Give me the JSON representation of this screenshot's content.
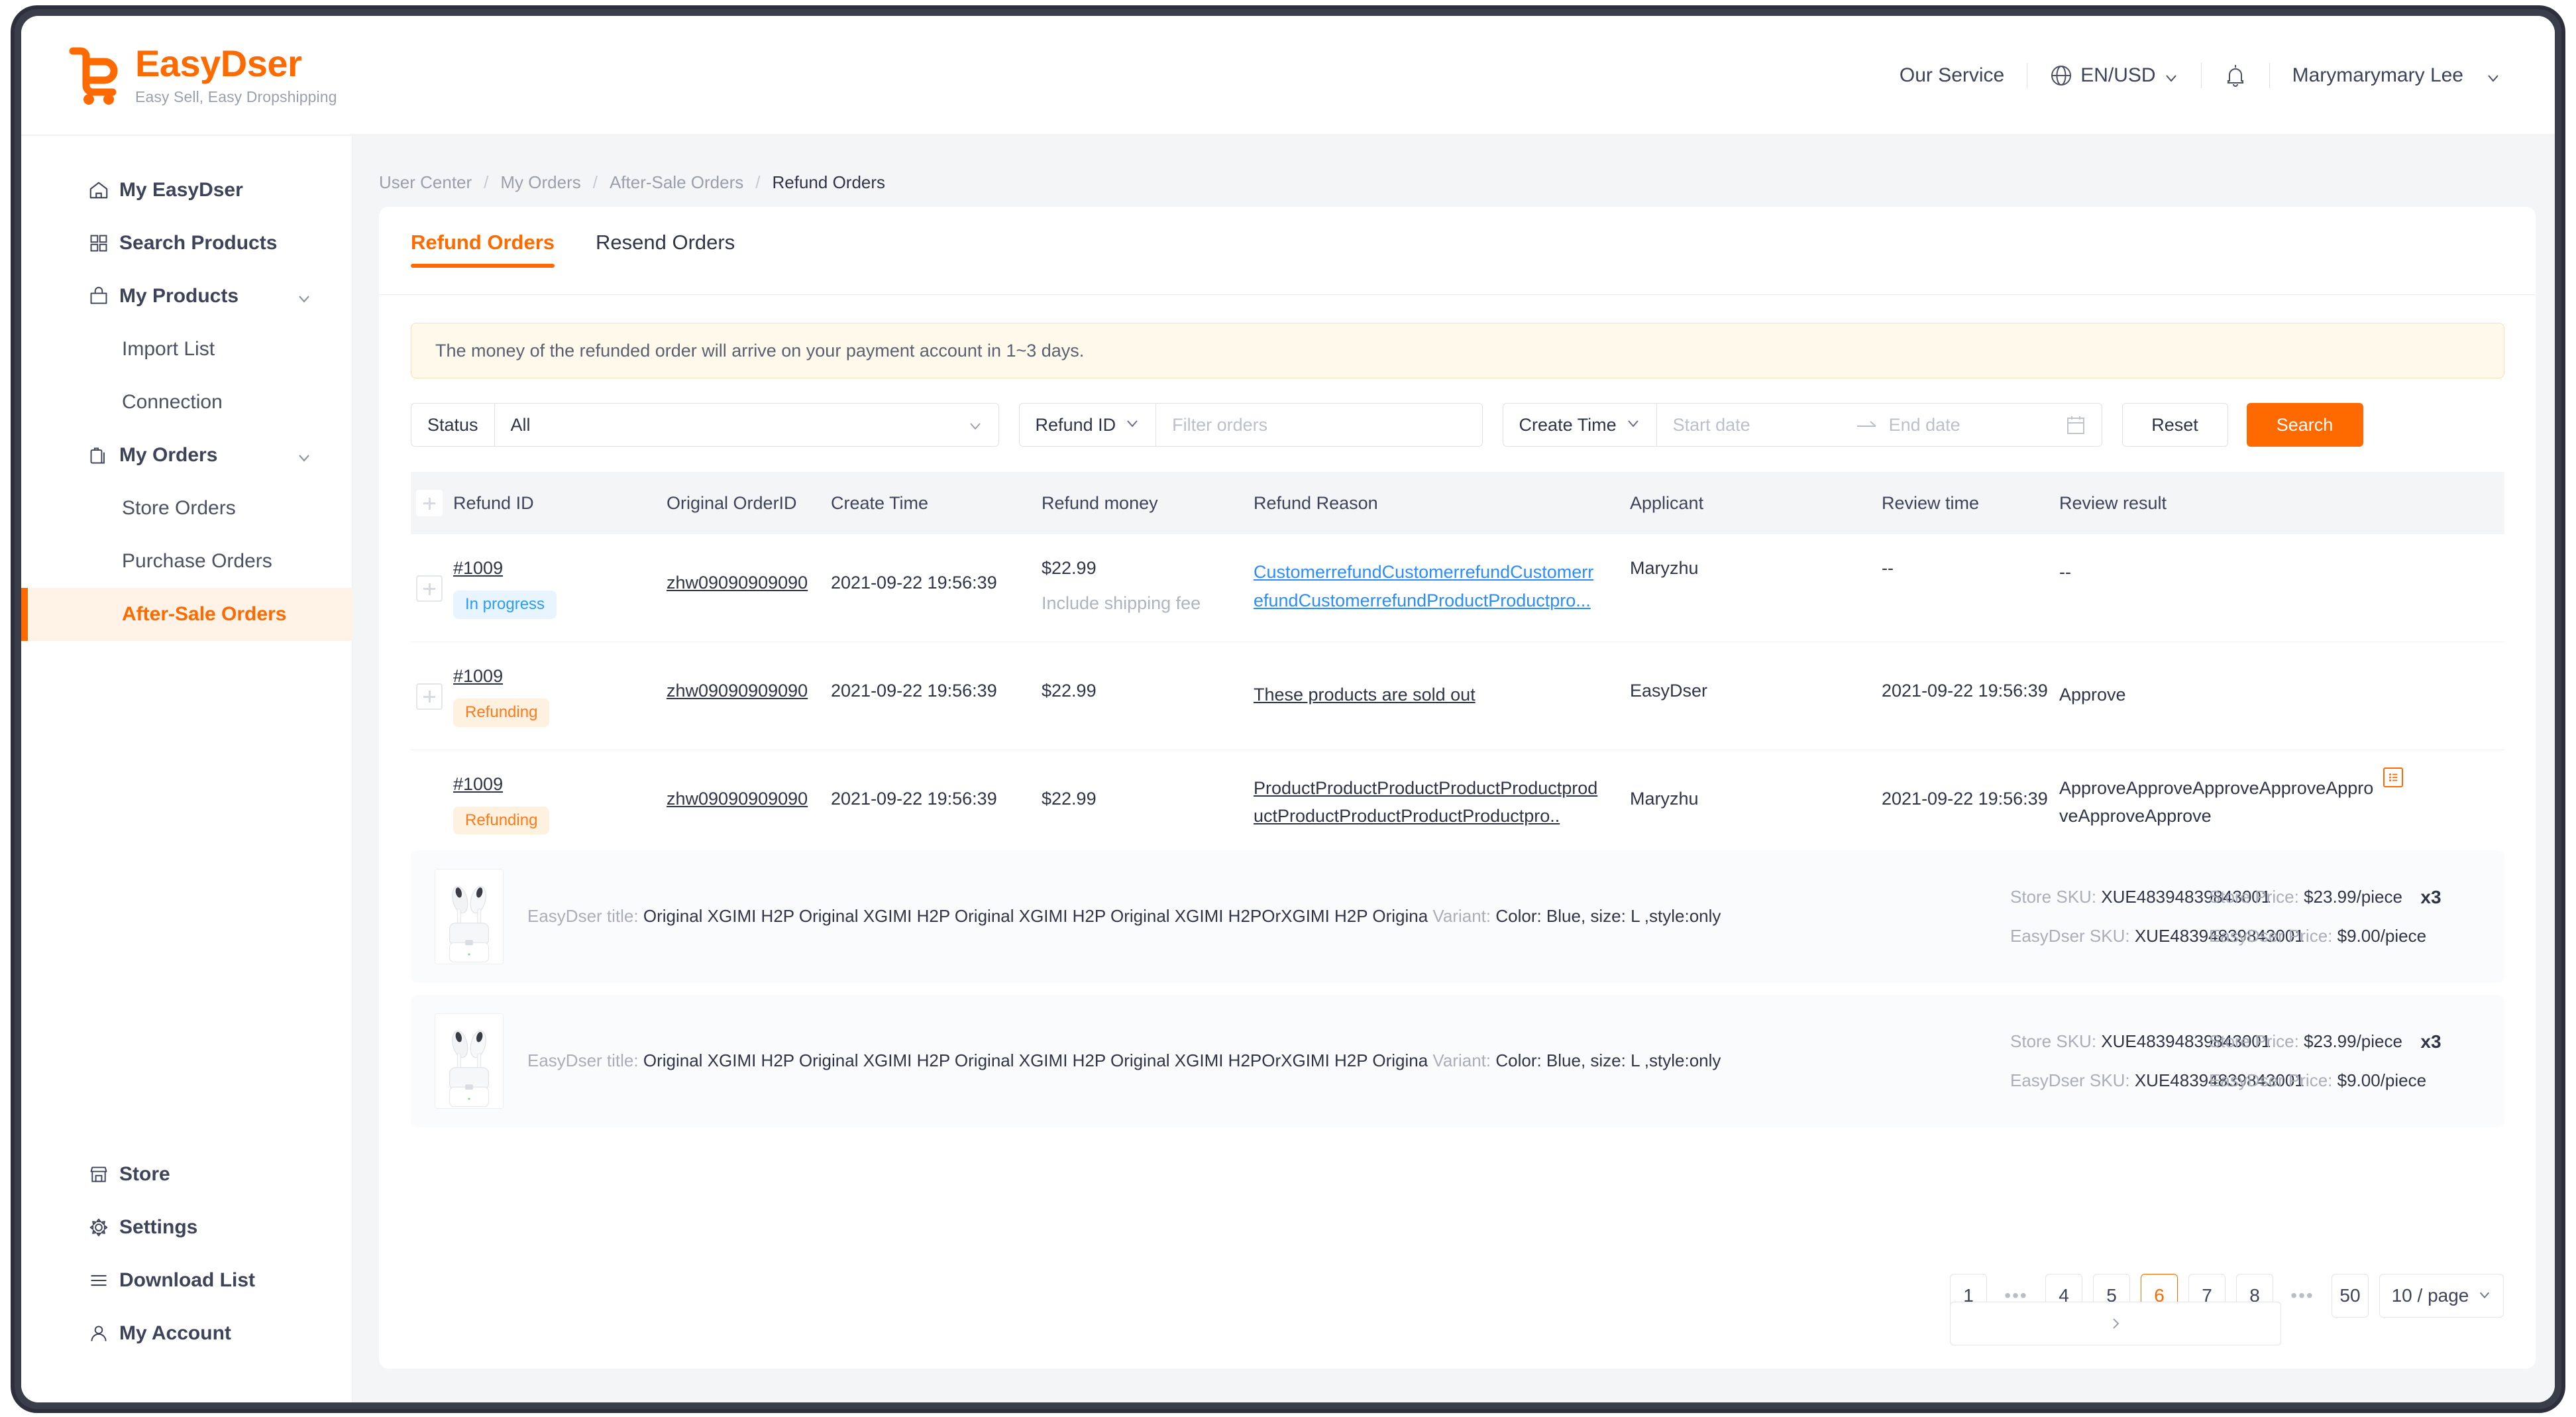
{
  "header": {
    "logo_title": "EasyDser",
    "logo_sub": "Easy Sell,  Easy Dropshipping",
    "our_service": "Our Service",
    "locale": "EN/USD",
    "user": "Marymarymary Lee",
    "accent": "#ff6a00"
  },
  "sidebar": {
    "items": [
      {
        "label": "My EasyDser",
        "icon": "home-icon",
        "type": "top"
      },
      {
        "label": "Search Products",
        "icon": "grid-icon",
        "type": "top"
      },
      {
        "label": "My Products",
        "icon": "bag-icon",
        "type": "top",
        "caret": true
      },
      {
        "label": "Import List",
        "type": "sub"
      },
      {
        "label": "Connection",
        "type": "sub"
      },
      {
        "label": "My Orders",
        "icon": "orders-icon",
        "type": "top",
        "caret": true
      },
      {
        "label": "Store Orders",
        "type": "sub"
      },
      {
        "label": "Purchase Orders",
        "type": "sub"
      },
      {
        "label": "After-Sale Orders",
        "type": "sub",
        "active": true
      }
    ],
    "bottom_items": [
      {
        "label": "Store",
        "icon": "store-icon"
      },
      {
        "label": "Settings",
        "icon": "gear-icon"
      },
      {
        "label": "Download List",
        "icon": "list-icon"
      },
      {
        "label": "My Account",
        "icon": "user-icon"
      }
    ]
  },
  "breadcrumb": [
    "User Center",
    "My  Orders",
    "After-Sale Orders",
    "Refund Orders"
  ],
  "tabs": [
    {
      "label": "Refund Orders",
      "active": true
    },
    {
      "label": "Resend Orders",
      "active": false
    }
  ],
  "notice": "The money of the refunded order will arrive on your payment account in 1~3 days.",
  "filters": {
    "status_label": "Status",
    "status_value": "All",
    "refund_id_label": "Refund ID",
    "refund_id_placeholder": "Filter orders",
    "create_time_label": "Create Time",
    "start_date_placeholder": "Start date",
    "end_date_placeholder": "End date",
    "reset_label": "Reset",
    "search_label": "Search"
  },
  "table": {
    "columns": [
      "Refund ID",
      "Original OrderID",
      "Create Time",
      "Refund money",
      "Refund Reason",
      "Applicant",
      "Review time",
      "Review result"
    ],
    "rows": [
      {
        "refund_id": "#1009",
        "status": "In progress",
        "status_kind": "progress",
        "order_id": "zhw09090909090",
        "create_time": "2021-09-22 19:56:39",
        "money": "$22.99",
        "money_sub": "Include shipping fee",
        "reason": "CustomerrefundCustomerrefundCustomerrefundCustomerrefundProductProductpro...",
        "reason_style": "link",
        "applicant": "Maryzhu",
        "review_time": "--",
        "review_result": "--",
        "has_detail_icon": false
      },
      {
        "refund_id": "#1009",
        "status": "Refunding",
        "status_kind": "refunding",
        "order_id": "zhw09090909090",
        "create_time": "2021-09-22 19:56:39",
        "money": "$22.99",
        "money_sub": "",
        "reason": "These products are sold out",
        "reason_style": "dark",
        "applicant": "EasyDser",
        "review_time": "2021-09-22 19:56:39",
        "review_result": "Approve",
        "has_detail_icon": false
      },
      {
        "refund_id": "#1009",
        "status": "Refunding",
        "status_kind": "refunding",
        "order_id": "zhw09090909090",
        "create_time": "2021-09-22 19:56:39",
        "money": "$22.99",
        "money_sub": "",
        "reason": "ProductProductProductProductProductproductProductProductProductProductpro..",
        "reason_style": "dark",
        "applicant": "Maryzhu",
        "review_time": "2021-09-22 19:56:39",
        "review_result": "ApproveApproveApproveApproveApproveApproveApprove",
        "has_detail_icon": true
      }
    ]
  },
  "products": [
    {
      "title_label": "EasyDser title:",
      "title": "Original XGIMI H2P Original XGIMI H2P Original XGIMI H2P Original XGIMI H2POrXGIMI H2P Origina",
      "variant_label": "Variant:",
      "variant": "Color: Blue, size: L ,style:only",
      "store_sku_label": "Store SKU:",
      "store_sku": "XUE48394839843001",
      "easydser_sku_label": "EasyDser SKU:",
      "easydser_sku": "XUE48394839843001",
      "store_price_label": "Store Price:",
      "store_price": "$23.99/piece",
      "easydser_price_label": "EasyDser Price:",
      "easydser_price": "$9.00/piece",
      "qty": "x3"
    },
    {
      "title_label": "EasyDser  title:",
      "title": "Original XGIMI H2P Original XGIMI H2P Original XGIMI H2P Original XGIMI H2POrXGIMI H2P Origina",
      "variant_label": "Variant:",
      "variant": "Color: Blue, size: L ,style:only",
      "store_sku_label": "Store SKU:",
      "store_sku": "XUE48394839843001",
      "easydser_sku_label": "EasyDser SKU:",
      "easydser_sku": "XUE48394839843001",
      "store_price_label": "Store Price:",
      "store_price": "$23.99/piece",
      "easydser_price_label": "EasyDser Price:",
      "easydser_price": "$9.00/piece",
      "qty": "x3"
    }
  ],
  "pagination": {
    "prev": "‹",
    "next": "›",
    "pages": [
      "1",
      "•••",
      "4",
      "5",
      "6",
      "7",
      "8",
      "•••",
      "50"
    ],
    "current": "6",
    "page_size": "10 / page"
  }
}
